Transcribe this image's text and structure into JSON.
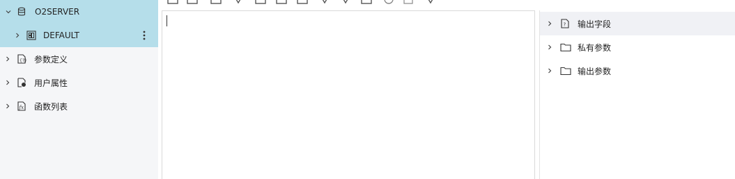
{
  "left_tree": {
    "server": {
      "label": "O2SERVER",
      "icon": "database-icon"
    },
    "db": {
      "label": "DEFAULT",
      "icon": "table-grid-icon"
    },
    "items": [
      {
        "label": "参数定义",
        "icon": "param-doc-icon"
      },
      {
        "label": "用户属性",
        "icon": "user-attr-icon"
      },
      {
        "label": "函数列表",
        "icon": "function-doc-icon"
      }
    ]
  },
  "right_tree": {
    "items": [
      {
        "label": "输出字段",
        "icon": "field-doc-icon"
      },
      {
        "label": "私有参数",
        "icon": "folder-icon"
      },
      {
        "label": "输出参数",
        "icon": "folder-icon"
      }
    ]
  },
  "colors": {
    "selected_bg": "#b5deea",
    "sidebar_bg": "#f5f6f8",
    "hover_bg": "#f0f1f5"
  }
}
